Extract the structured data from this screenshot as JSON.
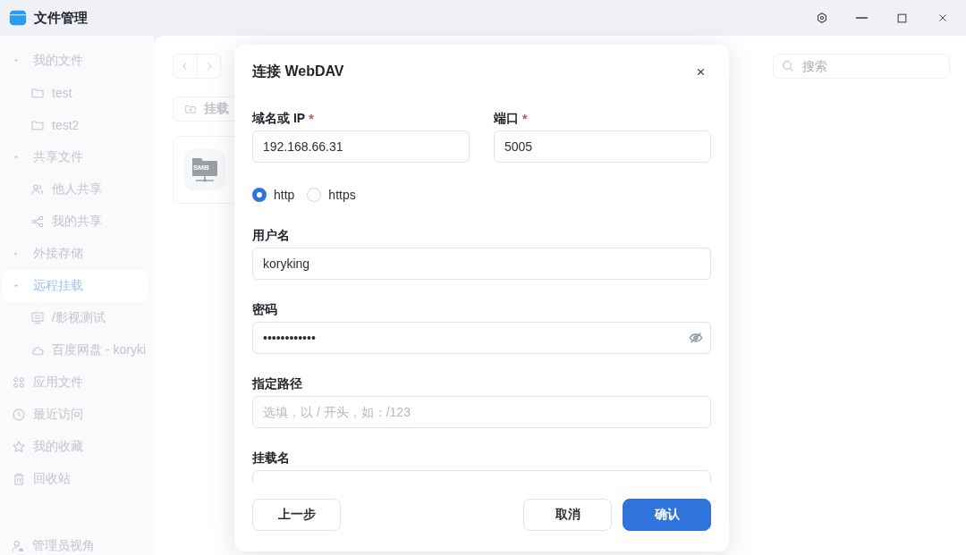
{
  "window": {
    "title": "文件管理"
  },
  "sidebar": {
    "items": [
      {
        "label": "我的文件",
        "kind": "group",
        "expanded": true,
        "selected": false,
        "children": [
          {
            "label": "test",
            "kind": "folder",
            "selected": false
          },
          {
            "label": "test2",
            "kind": "folder",
            "selected": false
          }
        ]
      },
      {
        "label": "共享文件",
        "kind": "group",
        "expanded": true,
        "selected": false,
        "children": [
          {
            "label": "他人共享",
            "kind": "users",
            "selected": false
          },
          {
            "label": "我的共享",
            "kind": "share",
            "selected": false
          }
        ]
      },
      {
        "label": "外接存储",
        "kind": "group",
        "expanded": false,
        "selected": false
      },
      {
        "label": "远程挂载",
        "kind": "group",
        "expanded": true,
        "selected": true,
        "children": [
          {
            "label": "/影视测试",
            "kind": "server",
            "selected": false
          },
          {
            "label": "百度网盘 - koryki",
            "kind": "cloud",
            "selected": false
          }
        ]
      },
      {
        "label": "应用文件",
        "kind": "apps",
        "selected": false
      },
      {
        "label": "最近访问",
        "kind": "clock",
        "selected": false
      },
      {
        "label": "我的收藏",
        "kind": "star",
        "selected": false
      },
      {
        "label": "回收站",
        "kind": "trash",
        "selected": false
      }
    ],
    "footer": {
      "label": "管理员视角"
    }
  },
  "toolbar": {
    "mount_button": "挂载",
    "search": {
      "placeholder": "搜索"
    }
  },
  "items": [
    {
      "badge": "SMB"
    }
  ],
  "dialog": {
    "title": "连接 WebDAV",
    "host": {
      "label": "域名或 IP",
      "required_mark": "*",
      "value": "192.168.66.31"
    },
    "port": {
      "label": "端口",
      "required_mark": "*",
      "value": "5005"
    },
    "protocols": [
      {
        "label": "http",
        "selected": true
      },
      {
        "label": "https",
        "selected": false
      }
    ],
    "fields": [
      {
        "kind": "text",
        "label": "用户名",
        "value": "koryking"
      },
      {
        "kind": "password",
        "label": "密码",
        "value": "••••••••••••"
      },
      {
        "kind": "text",
        "label": "指定路径",
        "placeholder": "选填，以 / 开头，如：/123"
      },
      {
        "kind": "text",
        "label": "挂载名"
      }
    ],
    "buttons": [
      {
        "label": "上一步",
        "kind": "back"
      },
      {
        "label": "取消",
        "kind": "default"
      },
      {
        "label": "确认",
        "kind": "primary"
      }
    ]
  }
}
